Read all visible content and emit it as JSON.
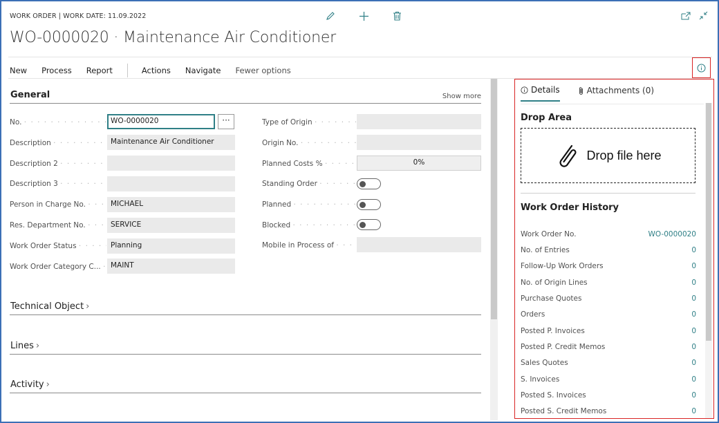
{
  "header": {
    "meta": "WORK ORDER | WORK DATE: 11.09.2022",
    "title": "WO-0000020 · Maintenance Air Conditioner",
    "icons": [
      "edit-icon",
      "add-icon",
      "delete-icon"
    ],
    "window_icons": [
      "open-new-window-icon",
      "collapse-icon"
    ]
  },
  "actions": {
    "new": "New",
    "process": "Process",
    "report": "Report",
    "actions": "Actions",
    "navigate": "Navigate",
    "fewer": "Fewer options"
  },
  "general": {
    "title": "General",
    "show_more": "Show more",
    "left_fields": [
      {
        "label": "No.",
        "value": "WO-0000020"
      },
      {
        "label": "Description",
        "value": "Maintenance Air Conditioner"
      },
      {
        "label": "Description 2",
        "value": ""
      },
      {
        "label": "Description 3",
        "value": ""
      },
      {
        "label": "Person in Charge No.",
        "value": "MICHAEL"
      },
      {
        "label": "Res. Department No.",
        "value": "SERVICE"
      },
      {
        "label": "Work Order Status",
        "value": "Planning"
      },
      {
        "label": "Work Order Category C...",
        "value": "MAINT"
      }
    ],
    "right_fields": [
      {
        "label": "Type of Origin",
        "value": ""
      },
      {
        "label": "Origin No.",
        "value": ""
      },
      {
        "label": "Planned Costs %",
        "value": "0%"
      },
      {
        "label": "Standing Order",
        "value": "off"
      },
      {
        "label": "Planned",
        "value": "off"
      },
      {
        "label": "Blocked",
        "value": "off"
      },
      {
        "label": "Mobile in Process of",
        "value": ""
      }
    ]
  },
  "sections": {
    "technical_object": "Technical Object",
    "lines": "Lines",
    "activity": "Activity"
  },
  "factbox": {
    "tab_details": "Details",
    "tab_attachments": "Attachments (0)",
    "drop_area_title": "Drop Area",
    "drop_text": "Drop file here",
    "history_title": "Work Order History",
    "history": [
      {
        "label": "Work Order No.",
        "value": "WO-0000020"
      },
      {
        "label": "No. of Entries",
        "value": "0"
      },
      {
        "label": "Follow-Up Work Orders",
        "value": "0"
      },
      {
        "label": "No. of Origin Lines",
        "value": "0"
      },
      {
        "label": "Purchase Quotes",
        "value": "0"
      },
      {
        "label": "Orders",
        "value": "0"
      },
      {
        "label": "Posted P. Invoices",
        "value": "0"
      },
      {
        "label": "Posted P. Credit Memos",
        "value": "0"
      },
      {
        "label": "Sales Quotes",
        "value": "0"
      },
      {
        "label": "S. Invoices",
        "value": "0"
      },
      {
        "label": "Posted S. Invoices",
        "value": "0"
      },
      {
        "label": "Posted S. Credit Memos",
        "value": "0"
      }
    ]
  },
  "colors": {
    "accent": "#2f7f86",
    "highlight_border": "#d92323",
    "frame": "#3b6fb6"
  }
}
